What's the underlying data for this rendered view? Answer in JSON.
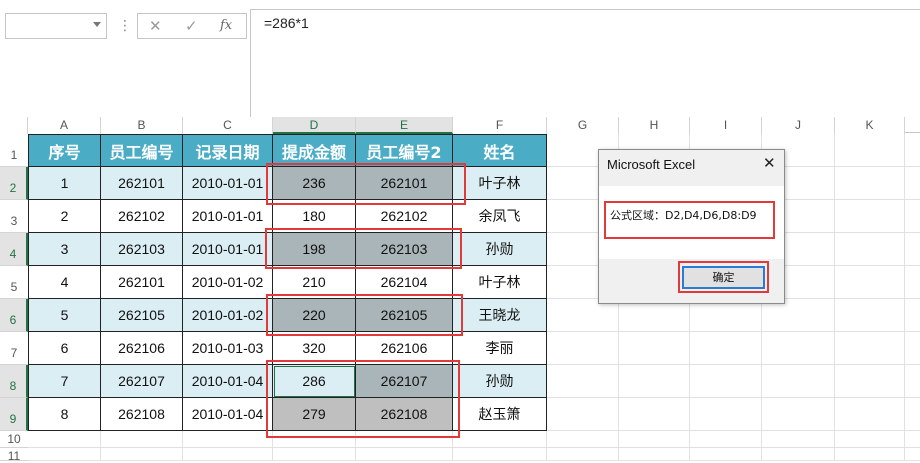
{
  "formula_bar": {
    "formula": "=286*1",
    "cancel_glyph": "✕",
    "enter_glyph": "✓",
    "fx_glyph": "fx"
  },
  "columns": [
    "A",
    "B",
    "C",
    "D",
    "E",
    "F",
    "G",
    "H",
    "I",
    "J",
    "K"
  ],
  "rows": [
    "1",
    "2",
    "3",
    "4",
    "5",
    "6",
    "7",
    "8",
    "9",
    "10",
    "11"
  ],
  "table": {
    "headers": [
      "序号",
      "员工编号",
      "记录日期",
      "提成金额",
      "员工编号2",
      "姓名"
    ],
    "rows": [
      [
        "1",
        "262101",
        "2010-01-01",
        "236",
        "262101",
        "叶子林"
      ],
      [
        "2",
        "262102",
        "2010-01-01",
        "180",
        "262102",
        "余凤飞"
      ],
      [
        "3",
        "262103",
        "2010-01-01",
        "198",
        "262103",
        "孙勋"
      ],
      [
        "4",
        "262101",
        "2010-01-02",
        "210",
        "262104",
        "叶子林"
      ],
      [
        "5",
        "262105",
        "2010-01-02",
        "220",
        "262105",
        "王晓龙"
      ],
      [
        "6",
        "262106",
        "2010-01-03",
        "320",
        "262106",
        "李丽"
      ],
      [
        "7",
        "262107",
        "2010-01-04",
        "286",
        "262107",
        "孙勋"
      ],
      [
        "8",
        "262108",
        "2010-01-04",
        "279",
        "262108",
        "赵玉箫"
      ]
    ]
  },
  "dialog": {
    "title": "Microsoft Excel",
    "message": "公式区域：D2,D4,D6,D8:D9",
    "ok_label": "确定",
    "close_glyph": "✕"
  },
  "colors": {
    "header_fill": "#4bacc6",
    "band_fill": "#dbeef3",
    "selection_fill": "#a9b5b8",
    "annotation": "#e23a3a",
    "excel_green": "#217346"
  }
}
